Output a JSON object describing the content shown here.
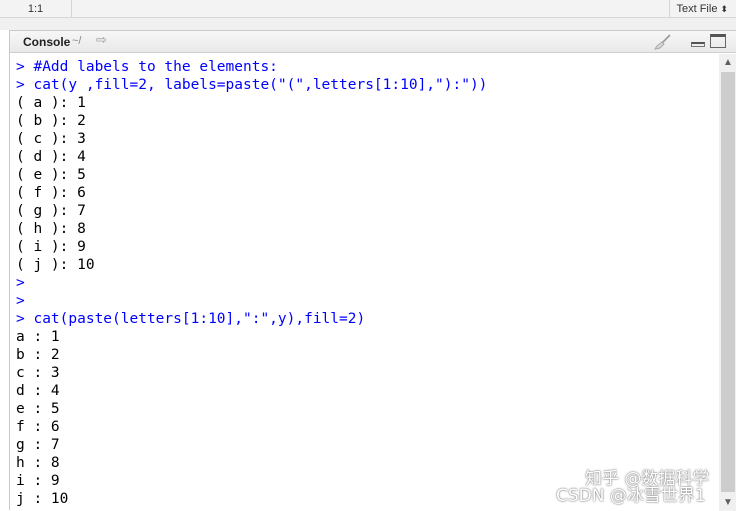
{
  "statusbar": {
    "cursor_position": "1:1",
    "file_type": "Text File",
    "file_type_arrows": "⬍"
  },
  "console": {
    "title": "Console",
    "path": "~/",
    "goto_icon": "arrow-right-icon",
    "clear_icon": "broom-icon",
    "lines": [
      {
        "kind": "cmd",
        "prompt": ">",
        "text": "#Add labels to the elements:"
      },
      {
        "kind": "cmd",
        "prompt": ">",
        "text": "cat(y ,fill=2, labels=paste(\"(\",letters[1:10],\"):\"))"
      },
      {
        "kind": "out",
        "text": "( a ): 1"
      },
      {
        "kind": "out",
        "text": "( b ): 2"
      },
      {
        "kind": "out",
        "text": "( c ): 3"
      },
      {
        "kind": "out",
        "text": "( d ): 4"
      },
      {
        "kind": "out",
        "text": "( e ): 5"
      },
      {
        "kind": "out",
        "text": "( f ): 6"
      },
      {
        "kind": "out",
        "text": "( g ): 7"
      },
      {
        "kind": "out",
        "text": "( h ): 8"
      },
      {
        "kind": "out",
        "text": "( i ): 9"
      },
      {
        "kind": "out",
        "text": "( j ): 10"
      },
      {
        "kind": "cmd",
        "prompt": ">",
        "text": ""
      },
      {
        "kind": "cmd",
        "prompt": ">",
        "text": ""
      },
      {
        "kind": "cmd",
        "prompt": ">",
        "text": "cat(paste(letters[1:10],\":\",y),fill=2)"
      },
      {
        "kind": "out",
        "text": "a : 1"
      },
      {
        "kind": "out",
        "text": "b : 2"
      },
      {
        "kind": "out",
        "text": "c : 3"
      },
      {
        "kind": "out",
        "text": "d : 4"
      },
      {
        "kind": "out",
        "text": "e : 5"
      },
      {
        "kind": "out",
        "text": "f : 6"
      },
      {
        "kind": "out",
        "text": "g : 7"
      },
      {
        "kind": "out",
        "text": "h : 8"
      },
      {
        "kind": "out",
        "text": "i : 9"
      },
      {
        "kind": "out",
        "text": "j : 10"
      }
    ]
  },
  "scrollbar": {
    "up_arrow": "▲",
    "down_arrow": "▼"
  },
  "watermark": {
    "line1": "知乎 @数据科学",
    "line2": "CSDN @冰雪世界1"
  },
  "colors": {
    "command": "#0000ff",
    "output": "#000000"
  }
}
